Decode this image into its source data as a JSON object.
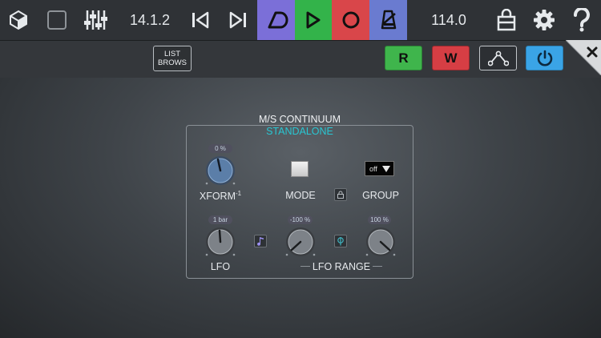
{
  "toolbar": {
    "position": "14.1.2",
    "tempo": "114.0"
  },
  "subbar": {
    "list_label": "LIST",
    "brows_label": "BROWS",
    "read_label": "R",
    "write_label": "W"
  },
  "plugin": {
    "title": "M/S CONTINUUM",
    "subtitle": "STANDALONE",
    "xform": {
      "value": "0 %",
      "label": "XFORM",
      "superscript": "-1"
    },
    "mode": {
      "label": "MODE"
    },
    "group": {
      "label": "GROUP",
      "value": "off"
    },
    "lfo": {
      "value": "1 bar",
      "label": "LFO"
    },
    "range_min": {
      "value": "-100 %"
    },
    "range_max": {
      "value": "100 %"
    },
    "range_label": "LFO RANGE"
  },
  "colors": {
    "loop": "#7b6fd8",
    "play": "#33b34a",
    "record": "#d9464a",
    "metronome": "#6a7bd0",
    "power": "#3aa4e6",
    "accent_text": "#29c7d3"
  }
}
